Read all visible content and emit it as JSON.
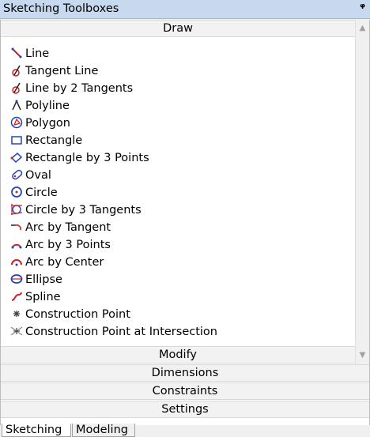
{
  "window": {
    "title": "Sketching Toolboxes",
    "pin_icon": "pin-icon"
  },
  "sections": {
    "draw": "Draw",
    "modify": "Modify",
    "dimensions": "Dimensions",
    "constraints": "Constraints",
    "settings": "Settings"
  },
  "tools": [
    {
      "label": "Line",
      "icon": "line-icon"
    },
    {
      "label": "Tangent Line",
      "icon": "tangent-line-icon"
    },
    {
      "label": "Line by 2 Tangents",
      "icon": "line-by-2-tangents-icon"
    },
    {
      "label": "Polyline",
      "icon": "polyline-icon"
    },
    {
      "label": "Polygon",
      "icon": "polygon-icon"
    },
    {
      "label": "Rectangle",
      "icon": "rectangle-icon"
    },
    {
      "label": "Rectangle by 3 Points",
      "icon": "rectangle-by-3-points-icon"
    },
    {
      "label": "Oval",
      "icon": "oval-icon"
    },
    {
      "label": "Circle",
      "icon": "circle-icon"
    },
    {
      "label": "Circle by 3 Tangents",
      "icon": "circle-by-3-tangents-icon"
    },
    {
      "label": "Arc by Tangent",
      "icon": "arc-by-tangent-icon"
    },
    {
      "label": "Arc by 3 Points",
      "icon": "arc-by-3-points-icon"
    },
    {
      "label": "Arc by Center",
      "icon": "arc-by-center-icon"
    },
    {
      "label": "Ellipse",
      "icon": "ellipse-icon"
    },
    {
      "label": "Spline",
      "icon": "spline-icon"
    },
    {
      "label": "Construction Point",
      "icon": "construction-point-icon"
    },
    {
      "label": "Construction Point at Intersection",
      "icon": "construction-point-intersection-icon"
    }
  ],
  "tabs": {
    "sketching": "Sketching",
    "modeling": "Modeling"
  }
}
